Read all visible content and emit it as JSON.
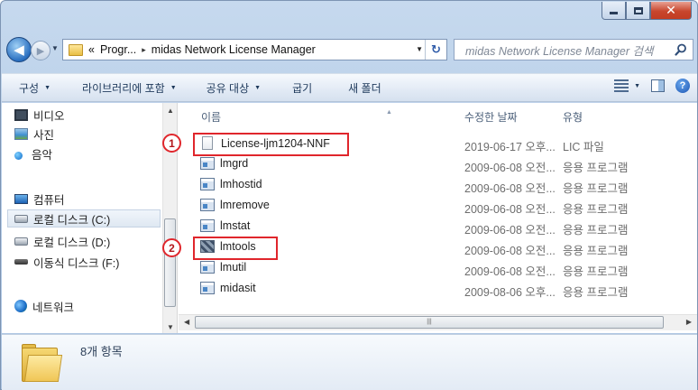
{
  "address": {
    "crumbs": [
      "«",
      "Progr...",
      "midas Network License Manager"
    ],
    "separator": "▸"
  },
  "search": {
    "placeholder": "midas Network License Manager 검색"
  },
  "toolbar": {
    "organize": "구성",
    "include_library": "라이브러리에 포함",
    "share_with": "공유 대상",
    "burn": "굽기",
    "new_folder": "새 폴더"
  },
  "nav": {
    "items": [
      "비디오",
      "사진",
      "음악",
      "컴퓨터",
      "로컬 디스크 (C:)",
      "로컬 디스크 (D:)",
      "이동식 디스크 (F:)",
      "네트워크"
    ],
    "selected": "로컬 디스크 (C:)"
  },
  "columns": {
    "name": "이름",
    "date": "수정한 날짜",
    "type": "유형"
  },
  "files": [
    {
      "name": "License-ljm1204-NNF",
      "date": "2019-06-17 오후...",
      "type": "LIC 파일",
      "icon": "license-file-icon"
    },
    {
      "name": "lmgrd",
      "date": "2009-06-08 오전...",
      "type": "응용 프로그램",
      "icon": "application-icon"
    },
    {
      "name": "lmhostid",
      "date": "2009-06-08 오전...",
      "type": "응용 프로그램",
      "icon": "application-icon"
    },
    {
      "name": "lmremove",
      "date": "2009-06-08 오전...",
      "type": "응용 프로그램",
      "icon": "application-icon"
    },
    {
      "name": "lmstat",
      "date": "2009-06-08 오전...",
      "type": "응용 프로그램",
      "icon": "application-icon"
    },
    {
      "name": "lmtools",
      "date": "2009-06-08 오전...",
      "type": "응용 프로그램",
      "icon": "lmtools-icon"
    },
    {
      "name": "lmutil",
      "date": "2009-06-08 오전...",
      "type": "응용 프로그램",
      "icon": "application-icon"
    },
    {
      "name": "midasit",
      "date": "2009-08-06 오후...",
      "type": "응용 프로그램",
      "icon": "application-icon"
    }
  ],
  "callouts": [
    "1",
    "2"
  ],
  "status": {
    "item_count": "8개 항목"
  },
  "colors": {
    "callout": "#e0262c",
    "frame": "#b9cfe8",
    "close_button": "#c8462d"
  }
}
